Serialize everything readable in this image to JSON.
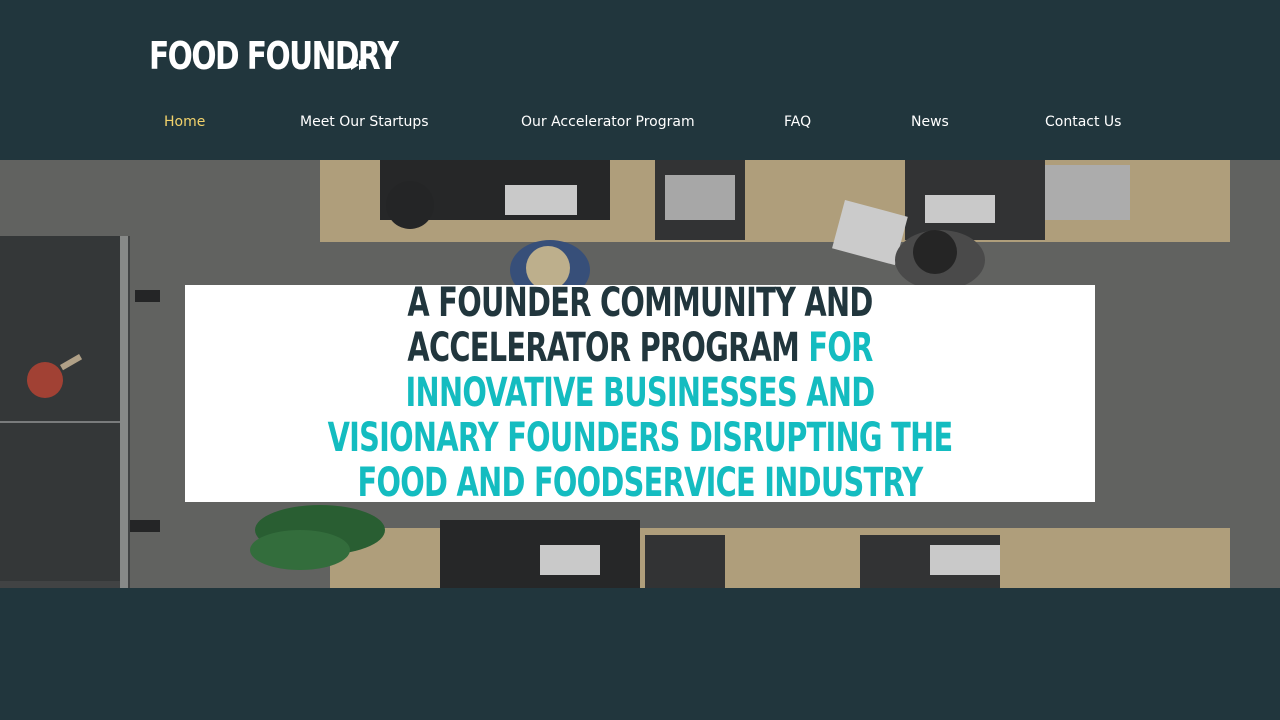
{
  "brand": {
    "name": "FOOD FOUNDRY",
    "icon": "fast-forward-icon"
  },
  "nav": {
    "items": [
      {
        "label": "Home",
        "active": true
      },
      {
        "label": "Meet Our Startups",
        "active": false
      },
      {
        "label": "Our Accelerator Program",
        "active": false
      },
      {
        "label": "FAQ",
        "active": false
      },
      {
        "label": "News",
        "active": false
      },
      {
        "label": "Contact Us",
        "active": false
      }
    ]
  },
  "hero": {
    "headline_dark": "A FOUNDER COMMUNITY AND ACCELERATOR PROGRAM",
    "headline_accent": "FOR INNOVATIVE BUSINESSES AND VISIONARY FOUNDERS DISRUPTING THE FOOD AND FOODSERVICE INDUSTRY",
    "background_image": "overhead office desks with people working on laptops"
  },
  "colors": {
    "background": "#21363d",
    "nav_active": "#f2d26b",
    "accent": "#14bcc0",
    "text": "#ffffff"
  }
}
